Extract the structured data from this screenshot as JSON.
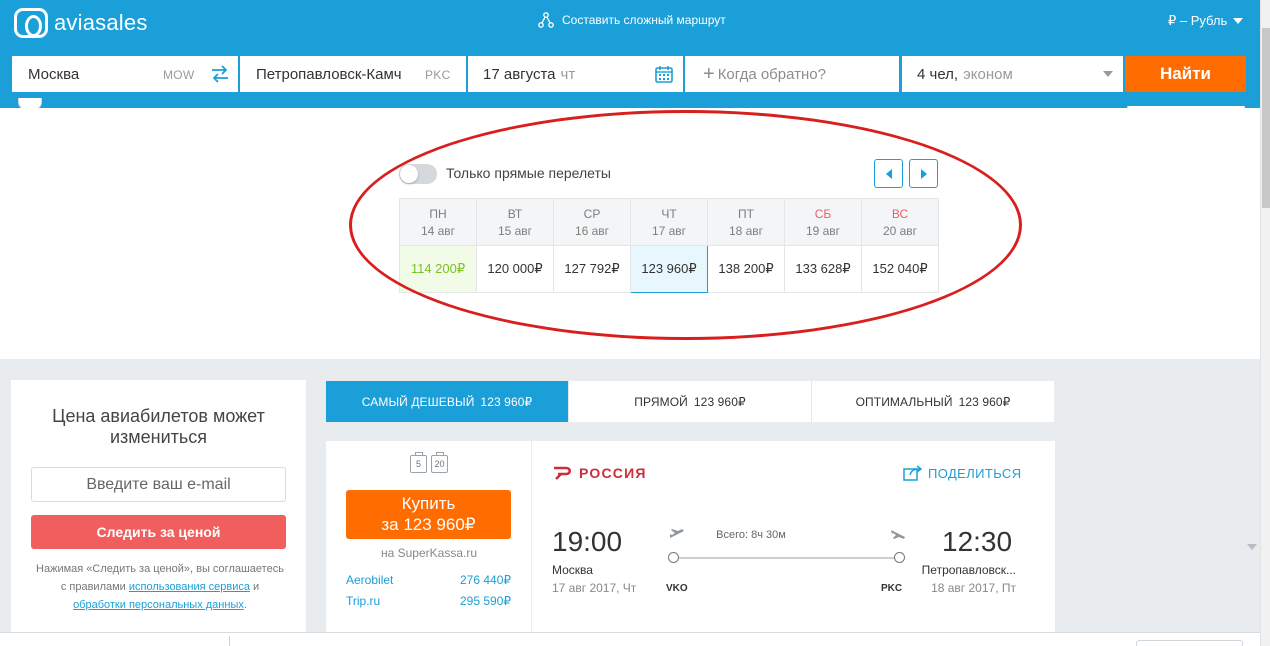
{
  "header": {
    "logo_text": "aviasales",
    "complex_route": "Составить сложный маршрут",
    "currency": "₽ – Рубль"
  },
  "search": {
    "from_city": "Москва",
    "from_iata": "MOW",
    "to_city": "Петропавловск-Камч",
    "to_iata": "PKC",
    "date": "17 августа",
    "date_dow": "чт",
    "return_placeholder": "Когда обратно?",
    "passengers": "4 чел,",
    "cabin": "эконом",
    "search_button": "Найти"
  },
  "calendar": {
    "direct_only_label": "Только прямые перелеты",
    "direct_only_enabled": false,
    "days": [
      {
        "dow": "ПН",
        "date": "14 авг",
        "price": "114 200₽",
        "cheapest": true,
        "selected": false,
        "weekend": false
      },
      {
        "dow": "ВТ",
        "date": "15 авг",
        "price": "120 000₽",
        "cheapest": false,
        "selected": false,
        "weekend": false
      },
      {
        "dow": "СР",
        "date": "16 авг",
        "price": "127 792₽",
        "cheapest": false,
        "selected": false,
        "weekend": false
      },
      {
        "dow": "ЧТ",
        "date": "17 авг",
        "price": "123 960₽",
        "cheapest": false,
        "selected": true,
        "weekend": false
      },
      {
        "dow": "ПТ",
        "date": "18 авг",
        "price": "138 200₽",
        "cheapest": false,
        "selected": false,
        "weekend": false
      },
      {
        "dow": "СБ",
        "date": "19 авг",
        "price": "133 628₽",
        "cheapest": false,
        "selected": false,
        "weekend": true
      },
      {
        "dow": "ВС",
        "date": "20 авг",
        "price": "152 040₽",
        "cheapest": false,
        "selected": false,
        "weekend": true
      }
    ]
  },
  "sidebar": {
    "title": "Цена авиабилетов может измениться",
    "email_placeholder": "Введите ваш e-mail",
    "watch_button": "Следить за ценой",
    "note_prefix": "Нажимая «Следить за ценой», вы соглашаетесь с правилами",
    "note_link1": "использования сервиса",
    "note_and": "и",
    "note_link2": "обработки персональных данных",
    "note_end": "."
  },
  "sort_tabs": [
    {
      "label": "САМЫЙ ДЕШЕВЫЙ",
      "price": "123 960₽",
      "active": true
    },
    {
      "label": "ПРЯМОЙ",
      "price": "123 960₽",
      "active": false
    },
    {
      "label": "ОПТИМАЛЬНЫЙ",
      "price": "123 960₽",
      "active": false
    }
  ],
  "ticket": {
    "baggage_1": "5",
    "baggage_2": "20",
    "buy_label": "Купить",
    "buy_price": "за 123 960₽",
    "agency": "на SuperKassa.ru",
    "offers": [
      {
        "name": "Aerobilet",
        "price": "276 440₽"
      },
      {
        "name": "Trip.ru",
        "price": "295 590₽"
      }
    ],
    "airline": "РОССИЯ",
    "share_label": "ПОДЕЛИТЬСЯ",
    "departure_time": "19:00",
    "departure_city": "Москва",
    "departure_date": "17 авг 2017, Чт",
    "departure_iata": "VKO",
    "arrival_time": "12:30",
    "arrival_city": "Петропавловск...",
    "arrival_date": "18 авг 2017, Пт",
    "arrival_iata": "PKC",
    "duration": "Всего: 8ч 30м"
  },
  "colors": {
    "brand_blue": "#1a9fd8",
    "search_orange": "#ff6d00",
    "watch_red": "#f05e5e",
    "cheapest_green": "#7ec123",
    "weekend_red": "#e4606d",
    "annotation_red": "#d91e1e"
  }
}
